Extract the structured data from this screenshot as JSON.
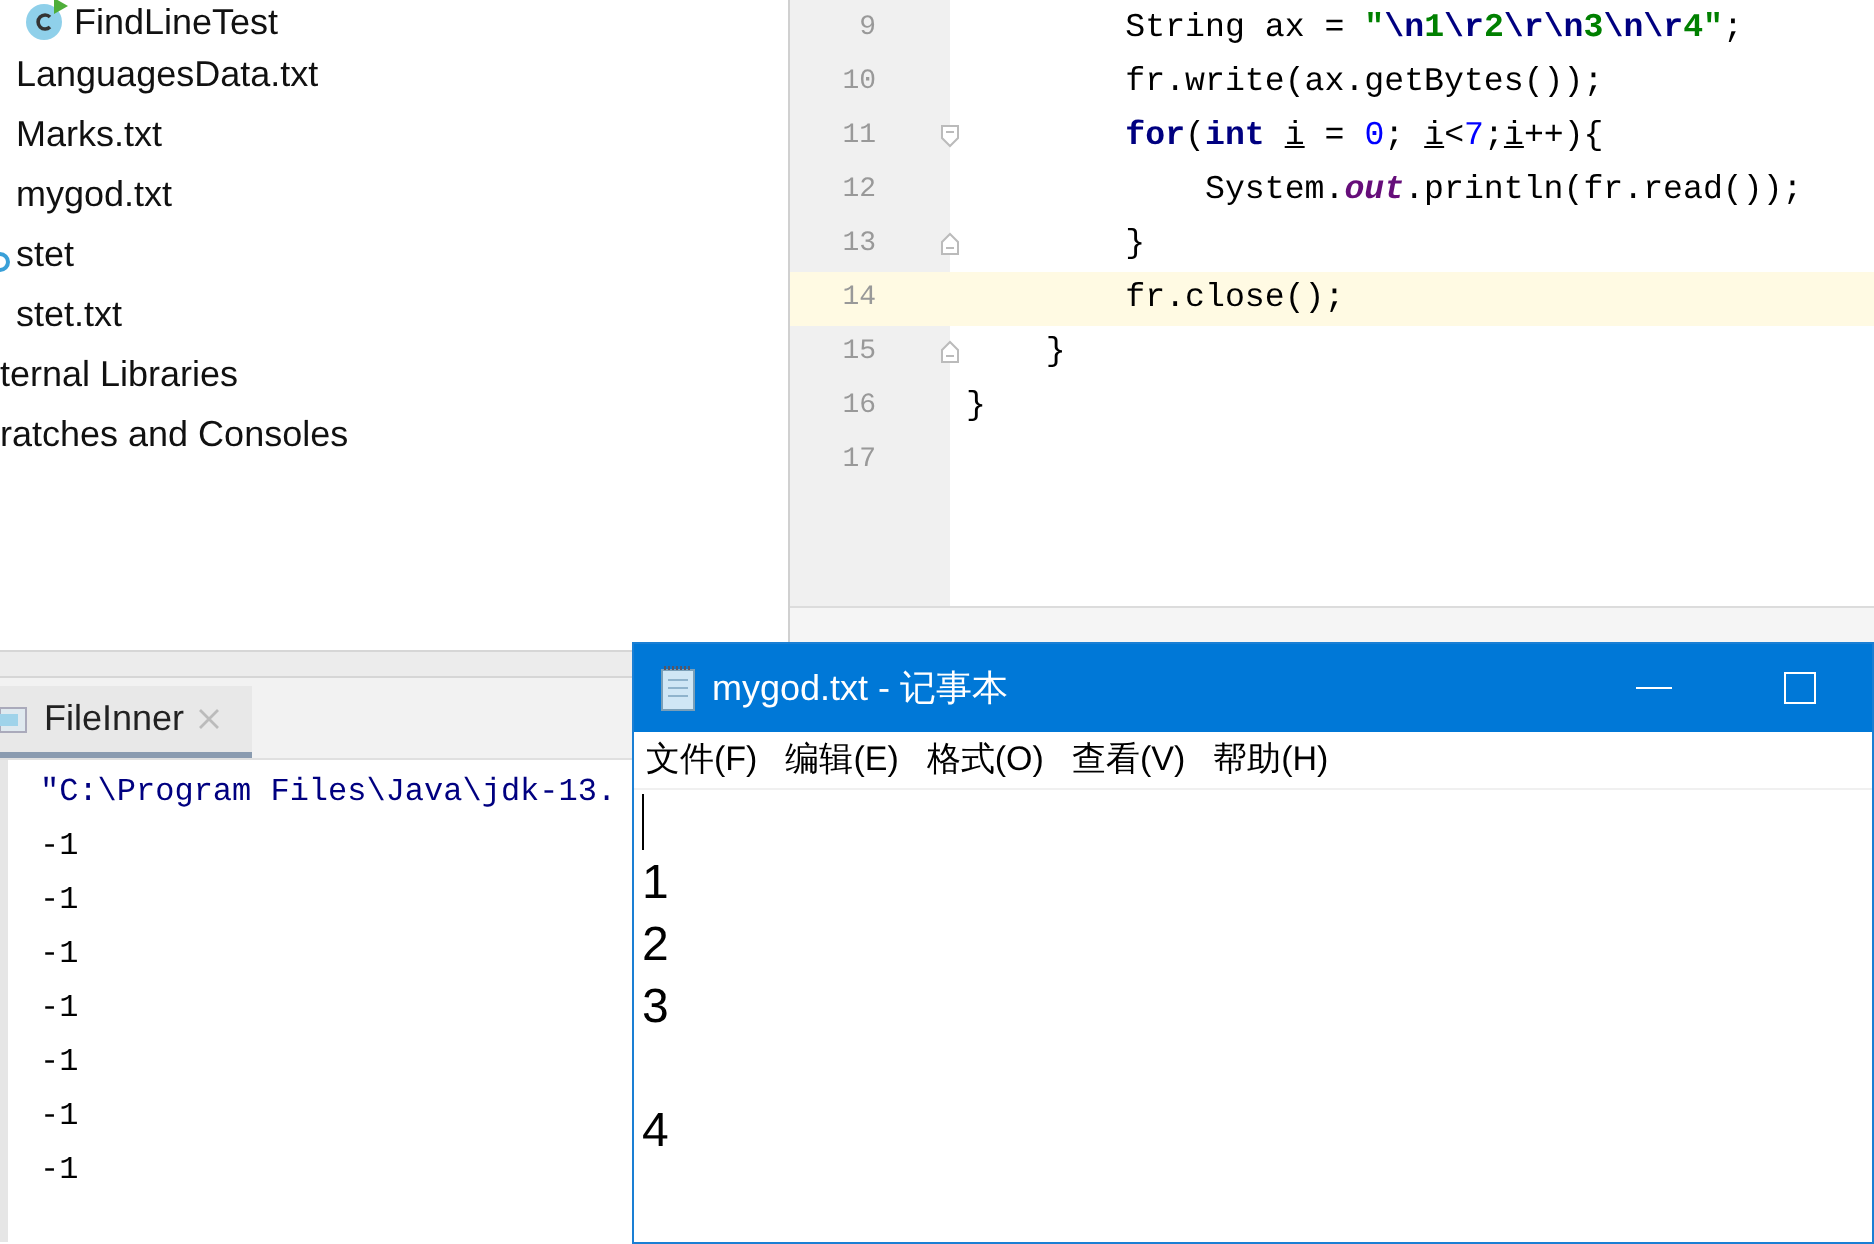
{
  "project_tree": {
    "items": [
      {
        "label": "FindLineTest",
        "kind": "class"
      },
      {
        "label": "LanguagesData.txt",
        "kind": "file"
      },
      {
        "label": "Marks.txt",
        "kind": "file"
      },
      {
        "label": "mygod.txt",
        "kind": "file"
      },
      {
        "label": "stet",
        "kind": "config"
      },
      {
        "label": "stet.txt",
        "kind": "file"
      },
      {
        "label": "ternal Libraries",
        "kind": "group"
      },
      {
        "label": "ratches and Consoles",
        "kind": "group"
      }
    ]
  },
  "editor": {
    "lines": [
      {
        "number": "9",
        "highlighted": false,
        "kind": "plain",
        "tokens": [
          {
            "text": "        String ax = ",
            "kind": "plain"
          },
          {
            "text": "\"",
            "kind": "string"
          },
          {
            "text": "\\n",
            "kind": "escape"
          },
          {
            "text": "1",
            "kind": "string"
          },
          {
            "text": "\\r",
            "kind": "escape"
          },
          {
            "text": "2",
            "kind": "string"
          },
          {
            "text": "\\r\\n",
            "kind": "escape"
          },
          {
            "text": "3",
            "kind": "string"
          },
          {
            "text": "\\n\\r",
            "kind": "escape"
          },
          {
            "text": "4\"",
            "kind": "string"
          },
          {
            "text": ";",
            "kind": "plain"
          }
        ]
      },
      {
        "number": "10",
        "highlighted": false,
        "kind": "plain",
        "tokens": [
          {
            "text": "        fr.write(ax.getBytes());",
            "kind": "plain"
          }
        ]
      },
      {
        "number": "11",
        "highlighted": false,
        "kind": "fold-start",
        "tokens": [
          {
            "text": "        for",
            "kind": "keyword"
          },
          {
            "text": "(",
            "kind": "plain"
          },
          {
            "text": "int ",
            "kind": "keyword"
          },
          {
            "text": "i",
            "kind": "variable"
          },
          {
            "text": " = ",
            "kind": "plain"
          },
          {
            "text": "0",
            "kind": "number"
          },
          {
            "text": "; ",
            "kind": "plain"
          },
          {
            "text": "i",
            "kind": "variable"
          },
          {
            "text": "<",
            "kind": "plain"
          },
          {
            "text": "7",
            "kind": "number"
          },
          {
            "text": ";",
            "kind": "plain"
          },
          {
            "text": "i",
            "kind": "variable"
          },
          {
            "text": "++){",
            "kind": "plain"
          }
        ]
      },
      {
        "number": "12",
        "highlighted": false,
        "kind": "plain",
        "tokens": [
          {
            "text": "            System.",
            "kind": "plain"
          },
          {
            "text": "out",
            "kind": "static"
          },
          {
            "text": ".println(fr.read());",
            "kind": "plain"
          }
        ]
      },
      {
        "number": "13",
        "highlighted": false,
        "kind": "fold-end",
        "tokens": [
          {
            "text": "        }",
            "kind": "plain"
          }
        ]
      },
      {
        "number": "14",
        "highlighted": true,
        "kind": "plain",
        "tokens": [
          {
            "text": "        fr.close();",
            "kind": "plain"
          }
        ]
      },
      {
        "number": "15",
        "highlighted": false,
        "kind": "fold-end",
        "tokens": [
          {
            "text": "    }",
            "kind": "plain"
          }
        ]
      },
      {
        "number": "16",
        "highlighted": false,
        "kind": "plain",
        "tokens": [
          {
            "text": "}",
            "kind": "plain"
          }
        ]
      },
      {
        "number": "17",
        "highlighted": false,
        "kind": "plain"
      }
    ]
  },
  "run_panel": {
    "tab": {
      "label": "FileInner",
      "selected": true
    },
    "output": [
      {
        "text": "\"C:\\Program Files\\Java\\jdk-13.",
        "kind": "command"
      },
      {
        "text": "-1",
        "kind": "output"
      },
      {
        "text": "-1",
        "kind": "output"
      },
      {
        "text": "-1",
        "kind": "output"
      },
      {
        "text": "-1",
        "kind": "output"
      },
      {
        "text": "-1",
        "kind": "output"
      },
      {
        "text": "-1",
        "kind": "output"
      },
      {
        "text": "-1",
        "kind": "output"
      }
    ]
  },
  "notepad": {
    "title": "mygod.txt - 记事本",
    "menu": [
      "文件(F)",
      "编辑(E)",
      "格式(O)",
      "查看(V)",
      "帮助(H)"
    ],
    "content": "\n1\n2\n3\n\n4"
  }
}
